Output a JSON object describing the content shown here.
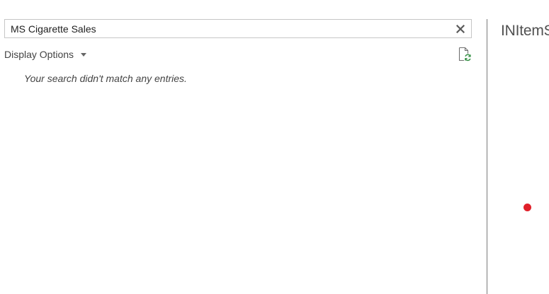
{
  "search": {
    "value": "MS Cigarette Sales",
    "clear_icon": "close-icon"
  },
  "display_options": {
    "label": "Display Options",
    "caret_icon": "caret-down-icon"
  },
  "refresh_icon": "refresh-document-icon",
  "results": {
    "empty_message": "Your search didn't match any entries."
  },
  "right_pane": {
    "title": "INItemS"
  },
  "colors": {
    "status_dot": "#e0202a",
    "refresh_accent": "#2e8b3e",
    "divider": "#7a7a7a"
  }
}
